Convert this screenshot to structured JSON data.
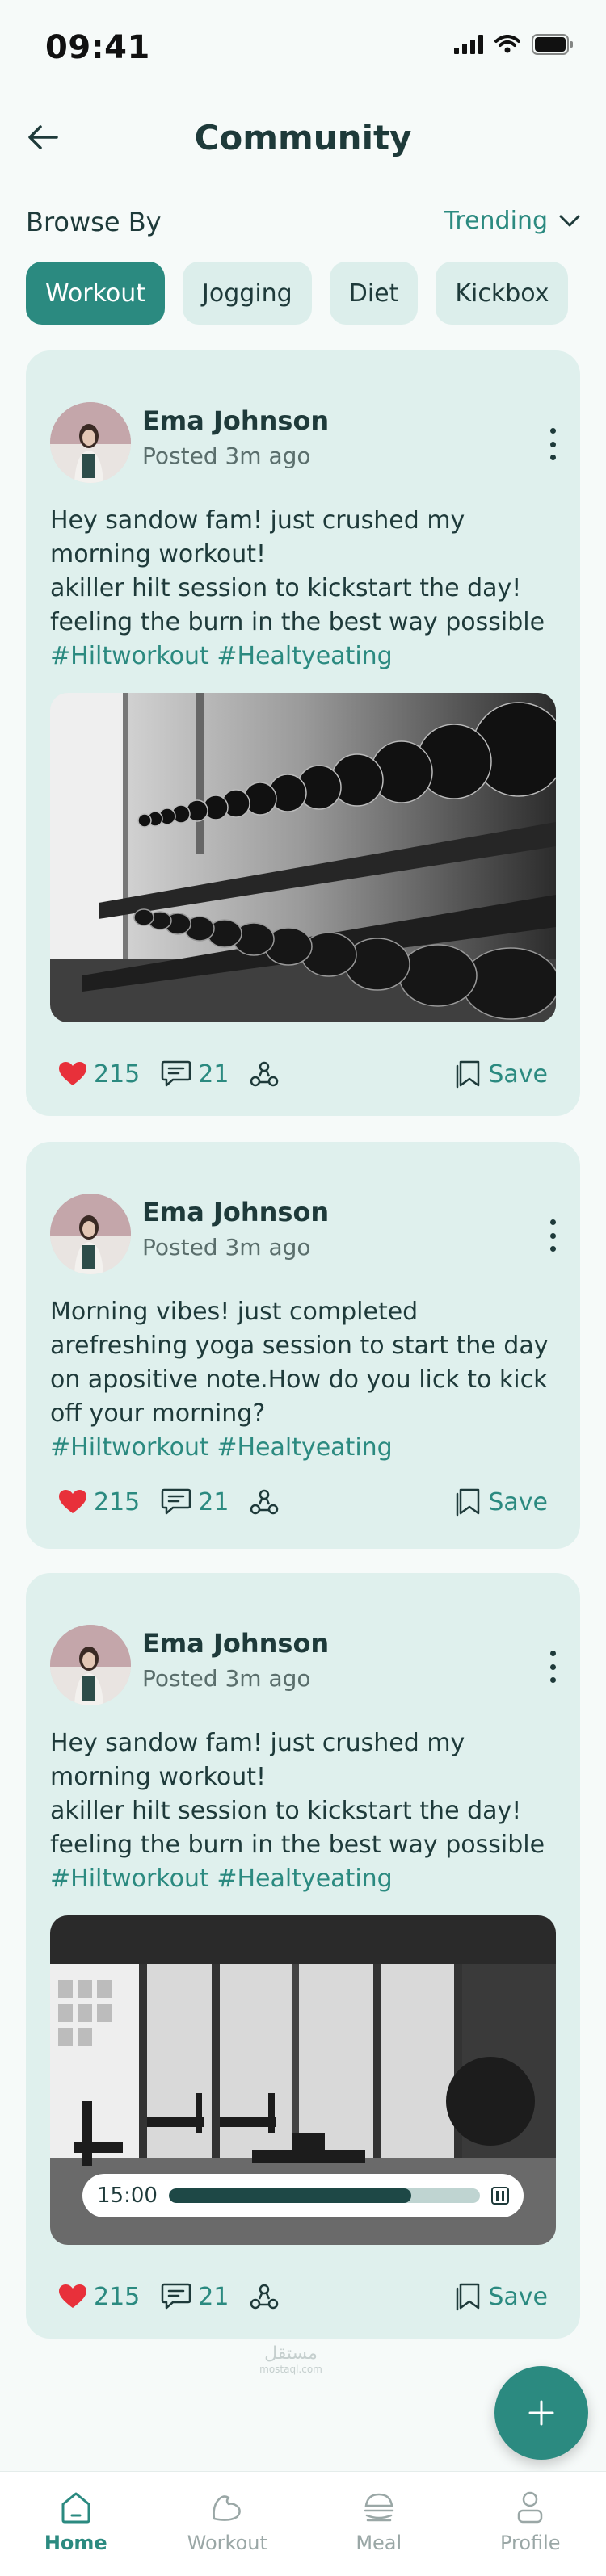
{
  "status_bar": {
    "time": "09:41"
  },
  "header": {
    "title": "Community"
  },
  "browse": {
    "label": "Browse By",
    "sort_value": "Trending"
  },
  "chips": [
    "Workout",
    "Jogging",
    "Diet",
    "Kickbox"
  ],
  "active_chip": "Workout",
  "posts": [
    {
      "author": "Ema Johnson",
      "posted": "Posted 3m ago",
      "lines": [
        "Hey sandow fam! just crushed my",
        "morning workout!",
        "akiller hilt session to kickstart the day!",
        "feeling the burn in the best way possible"
      ],
      "tags": "#Hiltworkout #Healtyeating",
      "media": "dumbbell-rack-photo",
      "likes": "215",
      "comments": "21",
      "save_label": "Save"
    },
    {
      "author": "Ema Johnson",
      "posted": "Posted 3m ago",
      "lines": [
        "Morning vibes! just completed",
        "arefreshing yoga session to start the day",
        "on apositive note.How do you lick to kick",
        "off your morning?"
      ],
      "tags": "#Hiltworkout #Healtyeating",
      "likes": "215",
      "comments": "21",
      "save_label": "Save"
    },
    {
      "author": "Ema Johnson",
      "posted": "Posted 3m ago",
      "lines": [
        "Hey sandow fam! just crushed my",
        "morning workout!",
        "akiller hilt session to kickstart the day!",
        "feeling the burn in the best way possible"
      ],
      "tags": "#Hiltworkout #Healtyeating",
      "media": "gym-video",
      "video_time": "15:00",
      "video_progress": 0.78,
      "likes": "215",
      "comments": "21",
      "save_label": "Save"
    }
  ],
  "bottom_nav": [
    {
      "label": "Home",
      "icon": "home-icon",
      "active": true
    },
    {
      "label": "Workout",
      "icon": "workout-icon",
      "active": false
    },
    {
      "label": "Meal",
      "icon": "meal-icon",
      "active": false
    },
    {
      "label": "Profile",
      "icon": "profile-icon",
      "active": false
    }
  ],
  "watermark": {
    "text": "مستقل",
    "sub": "mostaql.com"
  },
  "colors": {
    "accent": "#2b8a80",
    "card": "#dff0ed",
    "chip": "#dceeeb",
    "heart": "#e8303a"
  }
}
